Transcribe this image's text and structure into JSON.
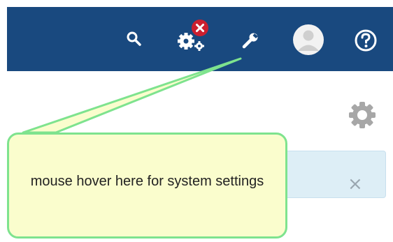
{
  "header": {
    "background": "#19497f",
    "icons": {
      "search": "search-icon",
      "system_settings_gears": "gears-icon",
      "error_badge": "close-icon",
      "wrench": "wrench-icon",
      "user_avatar": "user-avatar-icon",
      "help": "help-icon"
    },
    "badge_color": "#cc1f2f"
  },
  "main": {
    "panel_settings_icon": "gear-icon",
    "info_panel": {
      "background": "#ddeef6",
      "close_symbol": "×"
    }
  },
  "tooltip": {
    "text": "mouse hover here for system settings",
    "background": "#fafdcd",
    "border_color": "#7ee38e"
  }
}
